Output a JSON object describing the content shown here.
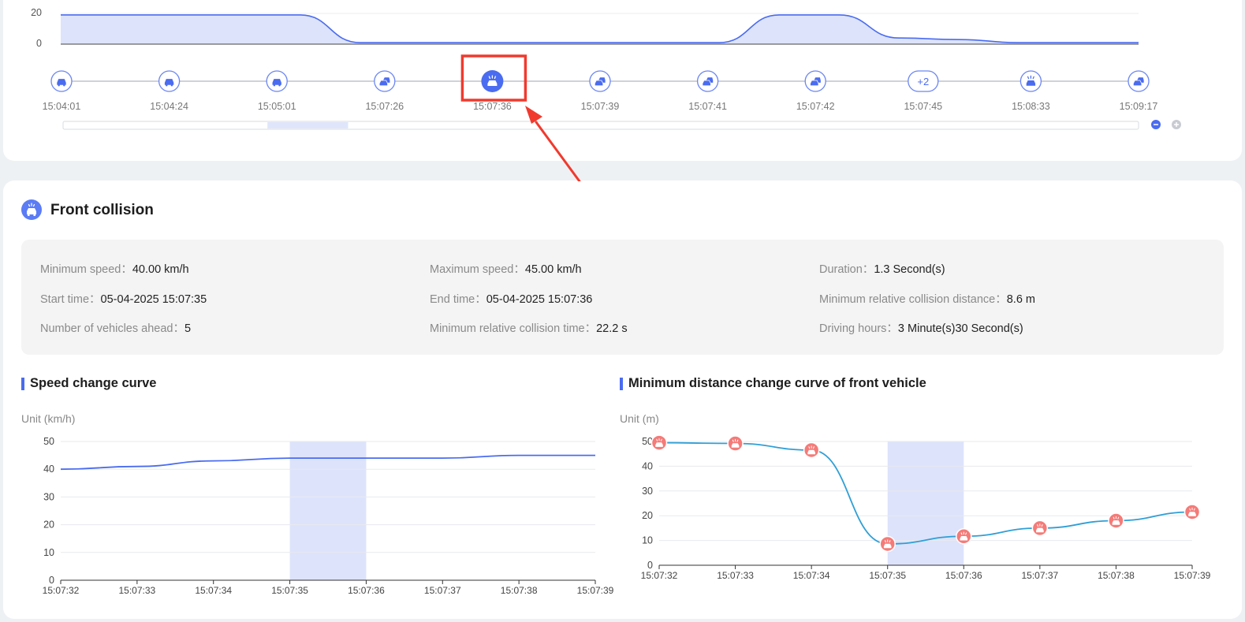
{
  "top_timeline": {
    "area_chart": {
      "y_ticks": [
        "20",
        "0"
      ],
      "values": [
        19,
        19,
        19,
        19,
        19,
        1,
        1,
        1,
        1,
        1,
        1,
        1,
        19,
        19,
        4,
        3,
        1,
        1,
        1
      ]
    },
    "events": [
      {
        "time": "15:04:01",
        "icon": "car-icon",
        "selected": false
      },
      {
        "time": "15:04:24",
        "icon": "car-icon",
        "selected": false
      },
      {
        "time": "15:05:01",
        "icon": "car-icon",
        "selected": false
      },
      {
        "time": "15:07:26",
        "icon": "following-car-icon",
        "selected": false
      },
      {
        "time": "15:07:36",
        "icon": "collision-alarm-icon",
        "selected": true
      },
      {
        "time": "15:07:39",
        "icon": "following-car-icon",
        "selected": false
      },
      {
        "time": "15:07:41",
        "icon": "following-car-icon",
        "selected": false
      },
      {
        "time": "15:07:42",
        "icon": "following-car-icon",
        "selected": false
      },
      {
        "time": "15:07:45",
        "icon": "group-badge",
        "badge": "+2",
        "selected": false
      },
      {
        "time": "15:08:33",
        "icon": "collision-alarm-icon",
        "selected": false
      },
      {
        "time": "15:09:17",
        "icon": "following-car-icon",
        "selected": false
      }
    ],
    "scrollbar": {
      "thumb_start": 0.19,
      "thumb_end": 0.265
    },
    "zoom_buttons": [
      "zoom-out-icon",
      "zoom-in-icon"
    ],
    "annotation_color": "#f03a2e"
  },
  "event": {
    "icon": "collision-alarm-icon",
    "title": "Front collision",
    "details": [
      {
        "label": "Minimum speed：",
        "value": "40.00 km/h"
      },
      {
        "label": "Maximum speed：",
        "value": "45.00 km/h"
      },
      {
        "label": "Duration：",
        "value": "1.3 Second(s)"
      },
      {
        "label": "Start time：",
        "value": "05-04-2025 15:07:35"
      },
      {
        "label": "End time：",
        "value": "05-04-2025 15:07:36"
      },
      {
        "label": "Minimum relative collision distance：",
        "value": "8.6 m"
      },
      {
        "label": "Number of vehicles ahead：",
        "value": "5"
      },
      {
        "label": "Minimum relative collision time：",
        "value": "22.2 s"
      },
      {
        "label": "Driving hours：",
        "value": "3 Minute(s)30 Second(s)"
      }
    ]
  },
  "colors": {
    "accent": "#4a6cf0",
    "band": "#dde3fb",
    "line2": "#2f9fd6",
    "marker": "#f47b78"
  },
  "chart_data": [
    {
      "type": "line",
      "title": "Speed change curve",
      "ylabel": "Unit (km/h)",
      "x": [
        "15:07:32",
        "15:07:33",
        "15:07:34",
        "15:07:35",
        "15:07:36",
        "15:07:37",
        "15:07:38",
        "15:07:39"
      ],
      "y_ticks": [
        "0",
        "10",
        "20",
        "30",
        "40",
        "50"
      ],
      "ylim": [
        0,
        50
      ],
      "series": [
        {
          "values": [
            40,
            41,
            43,
            44,
            44,
            44,
            45,
            45
          ]
        }
      ],
      "highlight": [
        "15:07:35",
        "15:07:36"
      ],
      "grid": true
    },
    {
      "type": "line",
      "title": "Minimum distance change curve of front vehicle",
      "ylabel": "Unit (m)",
      "x": [
        "15:07:32",
        "15:07:33",
        "15:07:34",
        "15:07:35",
        "15:07:36",
        "15:07:37",
        "15:07:38",
        "15:07:39"
      ],
      "y_ticks": [
        "0",
        "10",
        "20",
        "30",
        "40",
        "50"
      ],
      "ylim": [
        0,
        50
      ],
      "series": [
        {
          "values": [
            49.5,
            49.2,
            46.5,
            8.6,
            11.7,
            15,
            18,
            21.5
          ]
        }
      ],
      "highlight": [
        "15:07:35",
        "15:07:36"
      ],
      "grid": true,
      "markers": "collision-alarm-icon"
    }
  ]
}
